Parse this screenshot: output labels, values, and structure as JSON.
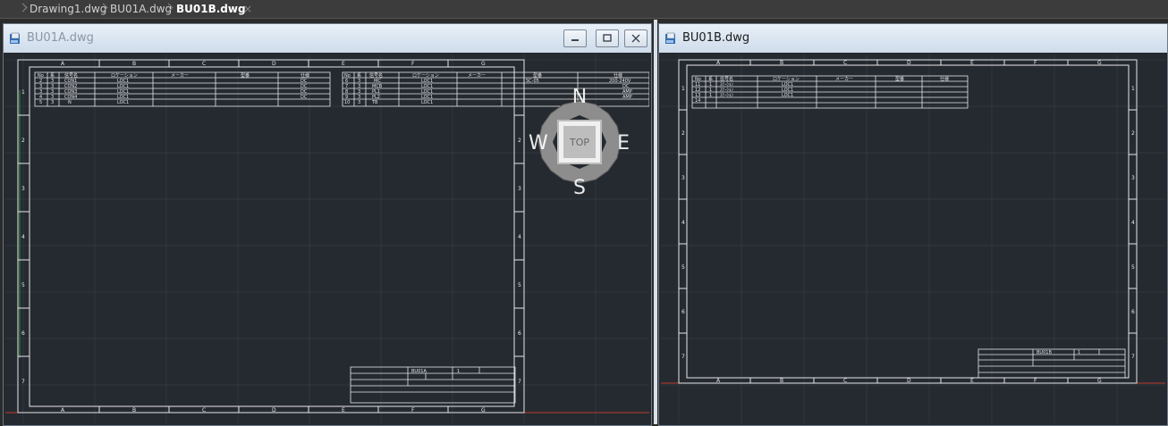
{
  "tabs": [
    {
      "label": "Drawing1.dwg",
      "active": false
    },
    {
      "label": "BU01A.dwg",
      "active": false
    },
    {
      "label": "BU01B.dwg",
      "active": true
    }
  ],
  "tab_close_glyph": "×",
  "window_left": {
    "title": "BU01A.dwg"
  },
  "window_right": {
    "title": "BU01B.dwg"
  },
  "viewcube": {
    "top": "TOP",
    "north": "N",
    "south": "S",
    "east": "E",
    "west": "W"
  },
  "sheet_a": {
    "col_letters": [
      "A",
      "B",
      "C",
      "D",
      "E",
      "F",
      "G"
    ],
    "row_numbers": [
      "1",
      "2",
      "3",
      "4",
      "5",
      "6",
      "7"
    ],
    "table_left": {
      "headers": [
        "No",
        "系",
        "信号名",
        "ロケーション",
        "メーカー",
        "型番",
        "仕様"
      ],
      "rows": [
        [
          "2",
          "3",
          "CON1",
          "LOC1",
          "",
          "",
          "DC"
        ],
        [
          "3",
          "3",
          "CON2",
          "LOC1",
          "",
          "",
          "DC"
        ],
        [
          "3",
          "3",
          "CON3",
          "LOC1",
          "",
          "",
          "DC"
        ],
        [
          "4",
          "3",
          "CON4",
          "LOC1",
          "",
          "",
          "DC"
        ],
        [
          "5",
          "3",
          "N",
          "LOC1",
          "",
          "",
          ""
        ]
      ]
    },
    "table_right": {
      "headers": [
        "No",
        "系",
        "信号名",
        "ロケーション",
        "メーカー",
        "型番",
        "仕様"
      ],
      "rows": [
        [
          "6",
          "3",
          "MC",
          "LOC1",
          "",
          "SC-05",
          "200-240V"
        ],
        [
          "7",
          "3",
          "MCB",
          "LOC1",
          "",
          "",
          "DC"
        ],
        [
          "8",
          "3",
          "PL1",
          "LOC1",
          "",
          "",
          "AMP"
        ],
        [
          "9",
          "3",
          "PL2",
          "LOC1",
          "",
          "",
          "AMP"
        ],
        [
          "10",
          "3",
          "TB",
          "LOC1",
          "",
          "",
          ""
        ]
      ]
    },
    "title_block": {
      "code": "BU01A",
      "sheet": "1"
    }
  },
  "sheet_b": {
    "col_letters": [
      "A",
      "B",
      "C",
      "D",
      "E",
      "F",
      "G"
    ],
    "row_numbers": [
      "1",
      "2",
      "3",
      "4",
      "5",
      "6",
      "7"
    ],
    "table": {
      "headers": [
        "No",
        "系",
        "信号名",
        "ロケーション",
        "メーカー",
        "型番",
        "仕様"
      ],
      "rows": [
        [
          "11",
          "1",
          "ｽﾃｰｼｮﾝ",
          "LOC1",
          "",
          "",
          ""
        ],
        [
          "12",
          "1",
          "ｽﾃｰｼｮﾝ",
          "LOC1",
          "",
          "",
          ""
        ],
        [
          "13",
          "1",
          "ｽﾃｰｼｮﾝ",
          "LOC1",
          "",
          "",
          ""
        ],
        [
          "14",
          "",
          "",
          "",
          "",
          "",
          ""
        ]
      ]
    },
    "title_block": {
      "code": "BU01B",
      "sheet": "1"
    }
  },
  "colors": {
    "model_bg": "#252a31",
    "grid": "#343b45",
    "linework": "#e6e6e6",
    "tab_bar": "#3c3c3c",
    "title_active": "#1a1a1a",
    "title_inactive": "#8a96a3",
    "axis_red": "#c0392b",
    "axis_green": "#2e7d32"
  },
  "icons": [
    "drawing-file-icon",
    "minimize-icon",
    "restore-icon",
    "close-icon",
    "tab-close-icon"
  ]
}
